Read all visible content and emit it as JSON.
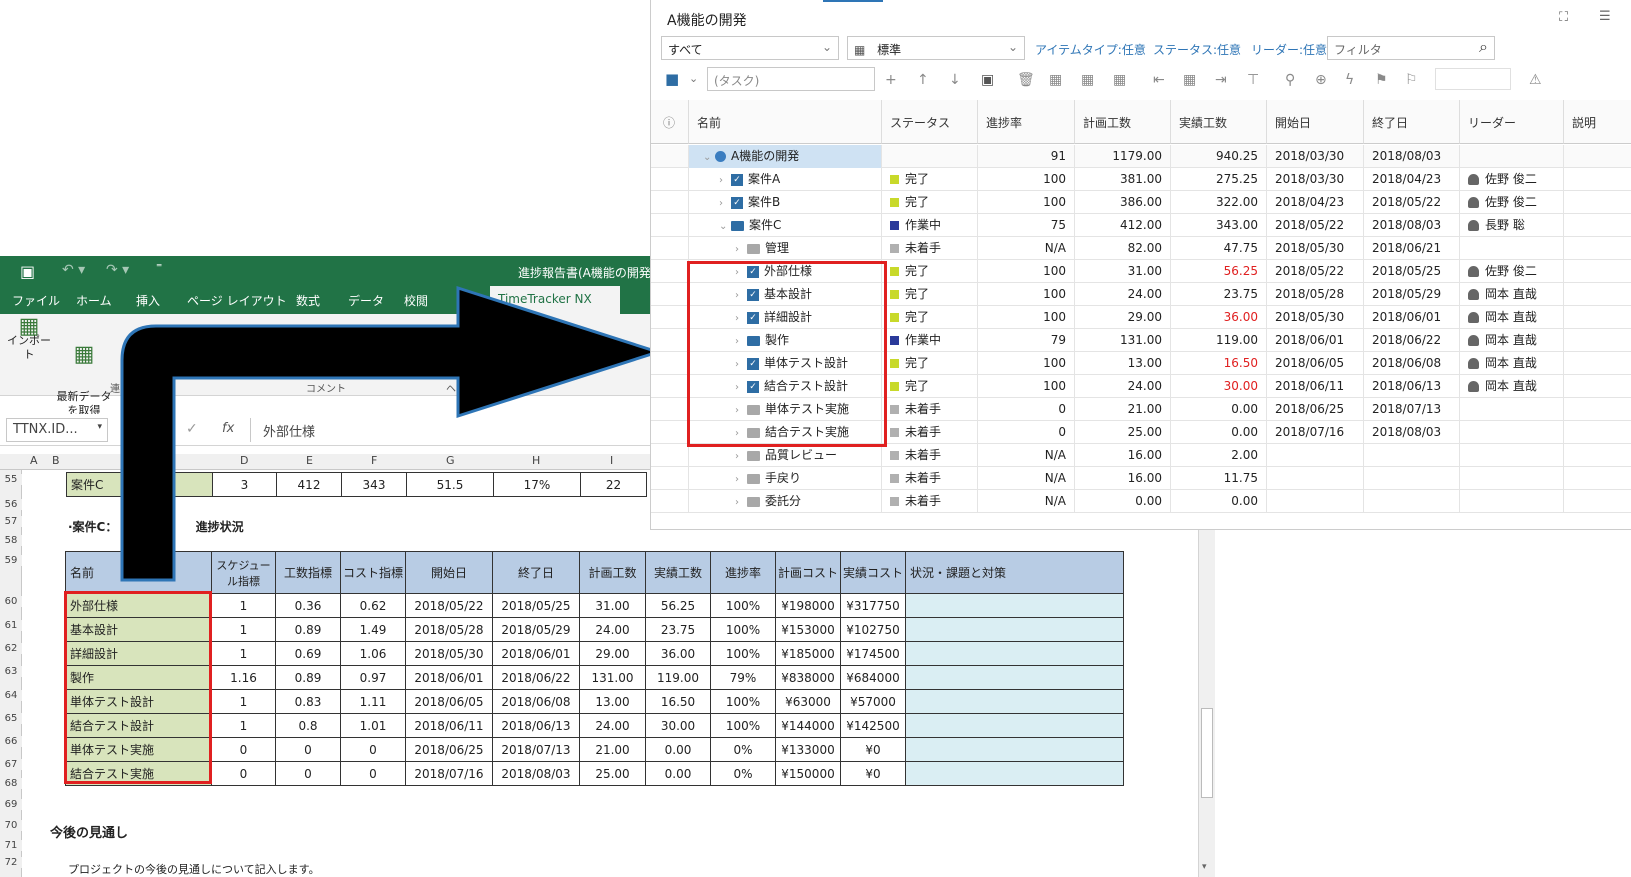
{
  "excel": {
    "title": "進捗報告書(A機能の開発",
    "tabs": [
      "ファイル",
      "ホーム",
      "挿入",
      "ページ レイアウト",
      "数式",
      "データ",
      "校閲"
    ],
    "addin_tab": "TimeTracker NX",
    "ribbon": {
      "import": "インポート",
      "fetch": "最新データ\nを取得",
      "comment_group": "コメント",
      "group_short": "連",
      "group_help": "ヘ"
    },
    "namebox": "TTNX.ID...",
    "formula": "外部仕様",
    "fx": "fx",
    "columns": [
      "A",
      "B",
      "",
      "D",
      "E",
      "F",
      "G",
      "H",
      "I"
    ],
    "row55": {
      "name": "案件C",
      "d": "3",
      "e": "412",
      "f": "343",
      "g": "51.5",
      "h": "17%",
      "i": "22"
    },
    "section_title": "·案件C：",
    "section_title_suffix": "進捗状況",
    "table_headers": [
      "名前",
      "スケジュール指標",
      "工数指標",
      "コスト指標",
      "開始日",
      "終了日",
      "計画工数",
      "実績工数",
      "進捗率",
      "計画コスト",
      "実績コスト",
      "状況・課題と対策"
    ],
    "rows": [
      [
        "外部仕様",
        "1",
        "0.36",
        "0.62",
        "2018/05/22",
        "2018/05/25",
        "31.00",
        "56.25",
        "100%",
        "¥198000",
        "¥317750"
      ],
      [
        "基本設計",
        "1",
        "0.89",
        "1.49",
        "2018/05/28",
        "2018/05/29",
        "24.00",
        "23.75",
        "100%",
        "¥153000",
        "¥102750"
      ],
      [
        "詳細設計",
        "1",
        "0.69",
        "1.06",
        "2018/05/30",
        "2018/06/01",
        "29.00",
        "36.00",
        "100%",
        "¥185000",
        "¥174500"
      ],
      [
        "製作",
        "1.16",
        "0.89",
        "0.97",
        "2018/06/01",
        "2018/06/22",
        "131.00",
        "119.00",
        "79%",
        "¥838000",
        "¥684000"
      ],
      [
        "単体テスト設計",
        "1",
        "0.83",
        "1.11",
        "2018/06/05",
        "2018/06/08",
        "13.00",
        "16.50",
        "100%",
        "¥63000",
        "¥57000"
      ],
      [
        "結合テスト設計",
        "1",
        "0.8",
        "1.01",
        "2018/06/11",
        "2018/06/13",
        "24.00",
        "30.00",
        "100%",
        "¥144000",
        "¥142500"
      ],
      [
        "単体テスト実施",
        "0",
        "0",
        "0",
        "2018/06/25",
        "2018/07/13",
        "21.00",
        "0.00",
        "0%",
        "¥133000",
        "¥0"
      ],
      [
        "結合テスト実施",
        "0",
        "0",
        "0",
        "2018/07/16",
        "2018/08/03",
        "25.00",
        "0.00",
        "0%",
        "¥150000",
        "¥0"
      ]
    ],
    "row_numbers": [
      "55",
      "56",
      "57",
      "58",
      "59",
      "60",
      "61",
      "62",
      "63",
      "64",
      "65",
      "66",
      "67",
      "68",
      "69",
      "70",
      "71",
      "72"
    ],
    "outlook_title": "今後の見通し",
    "outlook_text": "プロジェクトの今後の見通しについて記入します。"
  },
  "tt": {
    "title": "A機能の開発",
    "filter_all": "すべて",
    "view": "標準",
    "links": [
      "アイテムタイプ:任意",
      "ステータス:任意",
      "リーダー:任意"
    ],
    "filter_placeholder": "フィルタ",
    "task_placeholder": "(タスク)",
    "headers": [
      "名前",
      "ステータス",
      "進捗率",
      "計画工数",
      "実績工数",
      "開始日",
      "終了日",
      "リーダー",
      "説明"
    ],
    "rows": [
      {
        "name": "A機能の開発",
        "status": "",
        "prog": "91",
        "plan": "1179.00",
        "act": "940.25",
        "start": "2018/03/30",
        "end": "2018/08/03",
        "leader": ""
      },
      {
        "name": "案件A",
        "status": "完了",
        "prog": "100",
        "plan": "381.00",
        "act": "275.25",
        "start": "2018/03/30",
        "end": "2018/04/23",
        "leader": "佐野 俊二"
      },
      {
        "name": "案件B",
        "status": "完了",
        "prog": "100",
        "plan": "386.00",
        "act": "322.00",
        "start": "2018/04/23",
        "end": "2018/05/22",
        "leader": "佐野 俊二"
      },
      {
        "name": "案件C",
        "status": "作業中",
        "prog": "75",
        "plan": "412.00",
        "act": "343.00",
        "start": "2018/05/22",
        "end": "2018/08/03",
        "leader": "長野 聡"
      },
      {
        "name": "管理",
        "status": "未着手",
        "prog": "N/A",
        "plan": "82.00",
        "act": "47.75",
        "start": "2018/05/30",
        "end": "2018/06/21",
        "leader": ""
      },
      {
        "name": "外部仕様",
        "status": "完了",
        "prog": "100",
        "plan": "31.00",
        "act": "56.25",
        "start": "2018/05/22",
        "end": "2018/05/25",
        "leader": "佐野 俊二"
      },
      {
        "name": "基本設計",
        "status": "完了",
        "prog": "100",
        "plan": "24.00",
        "act": "23.75",
        "start": "2018/05/28",
        "end": "2018/05/29",
        "leader": "岡本 直哉"
      },
      {
        "name": "詳細設計",
        "status": "完了",
        "prog": "100",
        "plan": "29.00",
        "act": "36.00",
        "start": "2018/05/30",
        "end": "2018/06/01",
        "leader": "岡本 直哉"
      },
      {
        "name": "製作",
        "status": "作業中",
        "prog": "79",
        "plan": "131.00",
        "act": "119.00",
        "start": "2018/06/01",
        "end": "2018/06/22",
        "leader": "岡本 直哉"
      },
      {
        "name": "単体テスト設計",
        "status": "完了",
        "prog": "100",
        "plan": "13.00",
        "act": "16.50",
        "start": "2018/06/05",
        "end": "2018/06/08",
        "leader": "岡本 直哉"
      },
      {
        "name": "結合テスト設計",
        "status": "完了",
        "prog": "100",
        "plan": "24.00",
        "act": "30.00",
        "start": "2018/06/11",
        "end": "2018/06/13",
        "leader": "岡本 直哉"
      },
      {
        "name": "単体テスト実施",
        "status": "未着手",
        "prog": "0",
        "plan": "21.00",
        "act": "0.00",
        "start": "2018/06/25",
        "end": "2018/07/13",
        "leader": ""
      },
      {
        "name": "結合テスト実施",
        "status": "未着手",
        "prog": "0",
        "plan": "25.00",
        "act": "0.00",
        "start": "2018/07/16",
        "end": "2018/08/03",
        "leader": ""
      },
      {
        "name": "品質レビュー",
        "status": "未着手",
        "prog": "N/A",
        "plan": "16.00",
        "act": "2.00",
        "start": "",
        "end": "",
        "leader": ""
      },
      {
        "name": "手戻り",
        "status": "未着手",
        "prog": "N/A",
        "plan": "16.00",
        "act": "11.75",
        "start": "",
        "end": "",
        "leader": ""
      },
      {
        "name": "委託分",
        "status": "未着手",
        "prog": "N/A",
        "plan": "0.00",
        "act": "0.00",
        "start": "",
        "end": "",
        "leader": ""
      }
    ]
  },
  "colors": {
    "excel_green": "#217346",
    "done": "#c8d92a",
    "working": "#2a3a9a",
    "notstarted": "#b0b0b0",
    "highlight": "#e02020",
    "header_blue": "#b8cce4",
    "name_green": "#d8e4bc",
    "link": "#2e75b6"
  }
}
